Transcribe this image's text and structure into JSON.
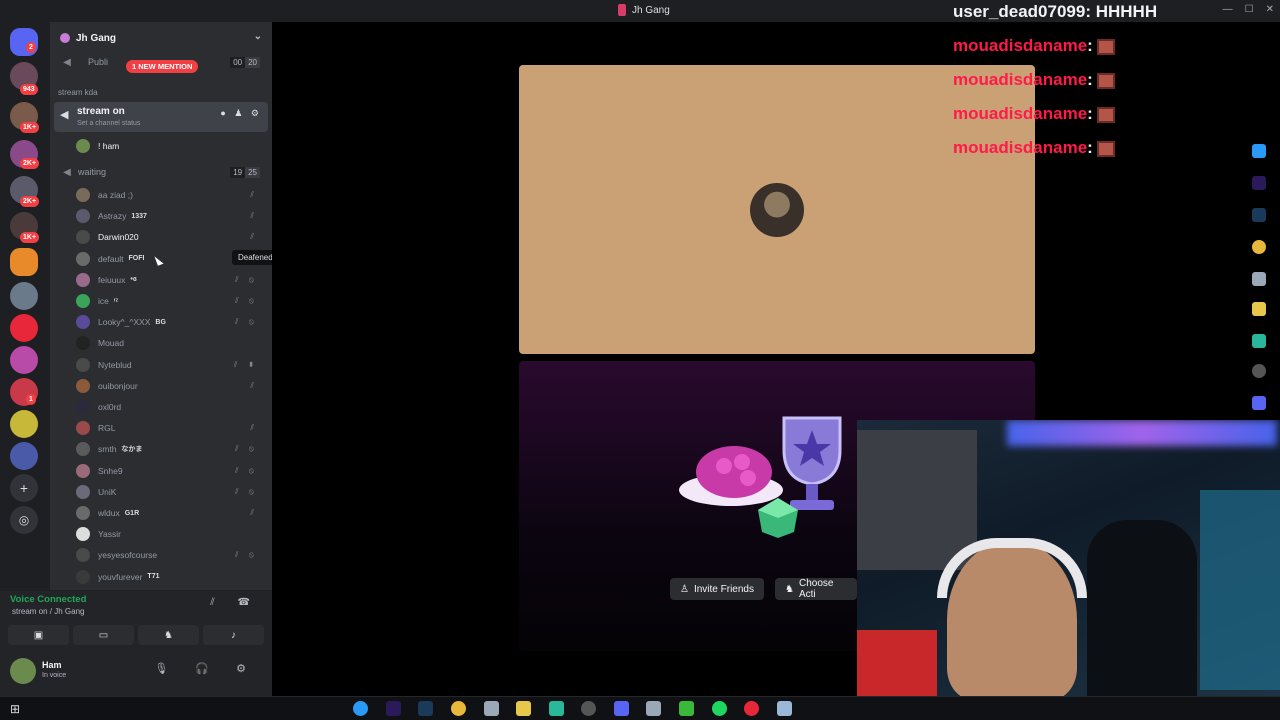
{
  "window": {
    "title": "Jh Gang"
  },
  "rail": {
    "badges": [
      "2",
      "943",
      "1K+",
      "2K+",
      "2K+",
      "1K+",
      "1"
    ]
  },
  "guild": {
    "name": "Jh Gang"
  },
  "channels": {
    "public": {
      "name": "Publi",
      "counts": [
        "00",
        "20"
      ],
      "mention": "1 NEW MENTION"
    },
    "category": "stream kda",
    "active": {
      "name": "stream on",
      "status": "Set a channel status"
    },
    "active_member": "! ham",
    "waiting": {
      "name": "waiting",
      "counts": [
        "19",
        "25"
      ]
    }
  },
  "members": [
    {
      "name": "aa ziad ;)",
      "tag": "",
      "color": "#7a6a5a"
    },
    {
      "name": "Astrazy",
      "tag": "1337",
      "color": "#5a5a6a"
    },
    {
      "name": "Darwin020",
      "tag": "",
      "color": "#4a4a4a"
    },
    {
      "name": "default",
      "tag": "FOFI",
      "color": "#6a6a6a"
    },
    {
      "name": "feiuuux",
      "tag": "•ɞ",
      "color": "#9a6a8a"
    },
    {
      "name": "ice",
      "tag": "ʳᶻ",
      "color": "#3aa55a"
    },
    {
      "name": "Looky^_^XXX",
      "tag": "BG",
      "color": "#5a4a9a"
    },
    {
      "name": "Mouad",
      "tag": "",
      "color": "#222222"
    },
    {
      "name": "Nyteblud",
      "tag": "",
      "color": "#4a4a4a"
    },
    {
      "name": "ouibonjour",
      "tag": "",
      "color": "#8a5a3a"
    },
    {
      "name": "oxl0rd",
      "tag": "",
      "color": "#2a2a3a"
    },
    {
      "name": "RGL",
      "tag": "",
      "color": "#9a4a4a"
    },
    {
      "name": "smth",
      "tag": "なかま",
      "color": "#5a5a5a"
    },
    {
      "name": "Snhe9",
      "tag": "",
      "color": "#9a6a7a"
    },
    {
      "name": "UniK",
      "tag": "",
      "color": "#6a6a7a"
    },
    {
      "name": "wldux",
      "tag": "G1R",
      "color": "#6a6a6a"
    },
    {
      "name": "Yassir",
      "tag": "",
      "color": "#dddddd"
    },
    {
      "name": "yesyesofcourse",
      "tag": "",
      "color": "#4a4a4a"
    },
    {
      "name": "youvfurever",
      "tag": "T71",
      "color": "#3a3a3a"
    }
  ],
  "tooltip": "Deafened",
  "voice": {
    "status": "Voice Connected",
    "location": "stream on / Jh Gang"
  },
  "user": {
    "name": "Ham",
    "status": "In voice"
  },
  "stage": {
    "invite_label": "Invite Friends",
    "activity_label": "Choose Acti"
  },
  "chat": [
    {
      "user": "user_dead07099",
      "text": ": HHHHH"
    },
    {
      "user": "mouadisdaname",
      "text": ":"
    },
    {
      "user": "mouadisdaname",
      "text": ":"
    },
    {
      "user": "mouadisdaname",
      "text": ":"
    },
    {
      "user": "mouadisdaname",
      "text": ":"
    }
  ],
  "colors": {
    "accent": "#5865f2",
    "voice_green": "#23a55a",
    "chat_red": "#ff1a4a",
    "mention_red": "#f23f43"
  }
}
